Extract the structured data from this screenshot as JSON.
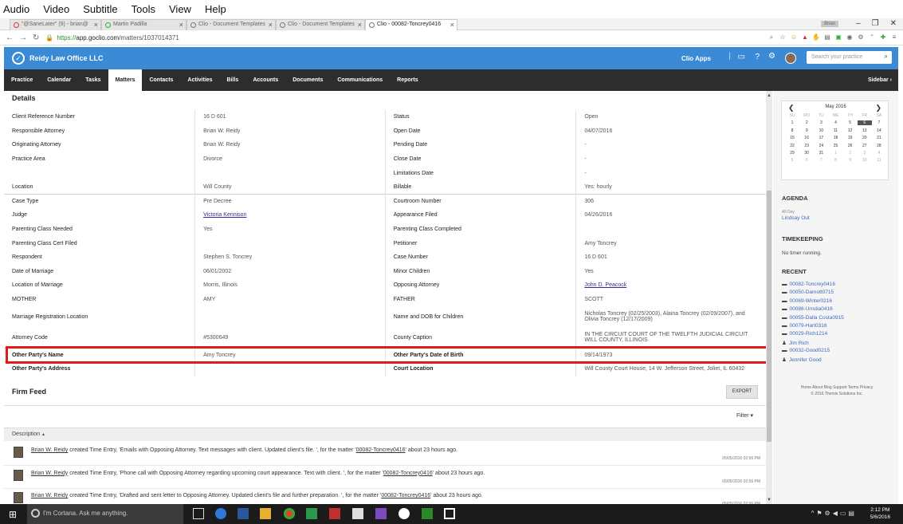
{
  "menubar": [
    "Audio",
    "Video",
    "Subtitle",
    "Tools",
    "View",
    "Help"
  ],
  "tabs": [
    {
      "label": "\"@SaneLater\" (9) - brian@"
    },
    {
      "label": "Martin Padilla"
    },
    {
      "label": "Clio - Document Templates"
    },
    {
      "label": "Clio - Document Templates"
    },
    {
      "label": "Clio - 00082-Toncrey0416"
    }
  ],
  "window_user": "Brian",
  "address": {
    "scheme": "https://",
    "host": "app.goclio.com",
    "path": "/matters/1037014371"
  },
  "topbar": {
    "firm": "Reidy Law Office LLC",
    "clio_apps": "Clio Apps",
    "search_placeholder": "Search your practice"
  },
  "nav": [
    "Practice",
    "Calendar",
    "Tasks",
    "Matters",
    "Contacts",
    "Activities",
    "Bills",
    "Accounts",
    "Documents",
    "Communications",
    "Reports"
  ],
  "nav_active": "Matters",
  "sidebar_label": "Sidebar",
  "details_title": "Details",
  "details": [
    {
      "l1": "Client Reference Number",
      "v1": "16 D 601",
      "l2": "Status",
      "v2": "Open"
    },
    {
      "l1": "Responsible Attorney",
      "v1": "Brian W. Reidy",
      "l2": "Open Date",
      "v2": "04/07/2016"
    },
    {
      "l1": "Originating Attorney",
      "v1": "Brian W. Reidy",
      "l2": "Pending Date",
      "v2": "-"
    },
    {
      "l1": "Practice Area",
      "v1": "Divorce",
      "l2": "Close Date",
      "v2": "-"
    },
    {
      "l1": "",
      "v1": "",
      "l2": "Limitations Date",
      "v2": "-"
    },
    {
      "l1": "Location",
      "v1": "Will County",
      "l2": "Billable",
      "v2": "Yes: hourly"
    },
    {
      "l1": "Case Type",
      "v1": "Pre Decree",
      "l2": "Courtroom Number",
      "v2": "306"
    },
    {
      "l1": "Judge",
      "v1": "Victoria Kennison",
      "l2": "Appearance Filed",
      "v2": "04/26/2016"
    },
    {
      "l1": "Parenting Class Needed",
      "v1": "Yes",
      "l2": "Parenting Class Completed",
      "v2": ""
    },
    {
      "l1": "Parenting Class Cert Filed",
      "v1": "",
      "l2": "Petitioner",
      "v2": "Amy Toncrey"
    },
    {
      "l1": "Respondent",
      "v1": "Stephen S. Toncrey",
      "l2": "Case Number",
      "v2": "16 D 601"
    },
    {
      "l1": "Date of Marriage",
      "v1": "06/01/2002",
      "l2": "Minor Children",
      "v2": "Yes"
    },
    {
      "l1": "Location of Marriage",
      "v1": "Morris, Illinois",
      "l2": "Opposing Attorney",
      "v2": "John D. Peacock"
    },
    {
      "l1": "MOTHER",
      "v1": "AMY",
      "l2": "FATHER",
      "v2": "SCOTT"
    },
    {
      "l1": "Marriage Registration Location",
      "v1": "",
      "l2": "Name and DOB for Children",
      "v2": "Nicholas Toncrey (02/25/2003), Alaina Toncrey (02/09/2007), and Olivia Toncrey (12/17/2009)"
    },
    {
      "l1": "Attorney Code",
      "v1": "#5300649",
      "l2": "County Caption",
      "v2": "IN THE CIRCUIT COURT OF THE TWELFTH JUDICIAL CIRCUIT WILL COUNTY, ILLINOIS"
    },
    {
      "l1": "Other Party's Name",
      "v1": "Amy Toncrey",
      "l2": "Other Party's Date of Birth",
      "v2": "09/14/1973"
    },
    {
      "l1": "Other Party's Address",
      "v1": "",
      "l2": "Court Location",
      "v2": "Will County Court House, 14 W. Jefferson Street, Joliet, IL 60432"
    }
  ],
  "feed": {
    "title": "Firm Feed",
    "export": "EXPORT",
    "filter": "Filter",
    "desc_head": "Description",
    "entries": [
      {
        "user": "Brian W. Reidy",
        "pre": " created Time Entry, 'Emails with Opposing Attorney. Text messages with client. Updated client's file. ', for the matter '",
        "matter": "00082-Toncrey0416",
        "post": "' about 23 hours ago.",
        "ts": "05/05/2016 02:56 PM"
      },
      {
        "user": "Brian W. Reidy",
        "pre": " created Time Entry, 'Phone call with Opposing Attorney regarding upcoming court appearance. Text with client. ', for the matter '",
        "matter": "00082-Toncrey0416",
        "post": "' about 23 hours ago.",
        "ts": "05/05/2016 02:56 PM"
      },
      {
        "user": "Brian W. Reidy",
        "pre": " created Time Entry, 'Drafted and sent letter to Opposing Attorney. Updated client's file and further preparation. ', for the matter '",
        "matter": "00082-Toncrey0416",
        "post": "' about 23 hours ago.",
        "ts": "05/05/2016 02:56 PM"
      }
    ]
  },
  "calendar": {
    "month": "May 2016",
    "dow": [
      "SU",
      "MO",
      "TU",
      "WE",
      "TH",
      "FR",
      "SA"
    ],
    "days": [
      [
        "1",
        ""
      ],
      [
        "2",
        ""
      ],
      [
        "3",
        ""
      ],
      [
        "4",
        ""
      ],
      [
        "5",
        ""
      ],
      [
        "6",
        "today"
      ],
      [
        "7",
        ""
      ],
      [
        "8",
        ""
      ],
      [
        "9",
        ""
      ],
      [
        "10",
        ""
      ],
      [
        "11",
        ""
      ],
      [
        "12",
        ""
      ],
      [
        "13",
        ""
      ],
      [
        "14",
        ""
      ],
      [
        "15",
        ""
      ],
      [
        "16",
        ""
      ],
      [
        "17",
        ""
      ],
      [
        "18",
        ""
      ],
      [
        "19",
        ""
      ],
      [
        "20",
        ""
      ],
      [
        "21",
        ""
      ],
      [
        "22",
        ""
      ],
      [
        "23",
        ""
      ],
      [
        "24",
        ""
      ],
      [
        "25",
        ""
      ],
      [
        "26",
        ""
      ],
      [
        "27",
        ""
      ],
      [
        "28",
        ""
      ],
      [
        "29",
        ""
      ],
      [
        "30",
        ""
      ],
      [
        "31",
        ""
      ],
      [
        "1",
        "dim"
      ],
      [
        "2",
        "dim"
      ],
      [
        "3",
        "dim"
      ],
      [
        "4",
        "dim"
      ],
      [
        "5",
        "dim"
      ],
      [
        "6",
        "dim"
      ],
      [
        "7",
        "dim"
      ],
      [
        "8",
        "dim"
      ],
      [
        "9",
        "dim"
      ],
      [
        "10",
        "dim"
      ],
      [
        "11",
        "dim"
      ]
    ]
  },
  "agenda": {
    "title": "AGENDA",
    "sub": "All Day",
    "item": "Lindsay Out"
  },
  "timekeeping": {
    "title": "TIMEKEEPING",
    "text": "No timer running."
  },
  "recent": {
    "title": "RECENT",
    "items": [
      {
        "label": "00082-Toncrey0416",
        "icon": "briefcase-icon"
      },
      {
        "label": "00050-Damott0715",
        "icon": "briefcase-icon"
      },
      {
        "label": "00069-Winter0216",
        "icon": "briefcase-icon"
      },
      {
        "label": "00086-Urrutia0416",
        "icon": "briefcase-icon"
      },
      {
        "label": "00055-Dalla Costa0915",
        "icon": "briefcase-icon"
      },
      {
        "label": "00079-Hart0316",
        "icon": "briefcase-icon"
      },
      {
        "label": "00029-Rich1214",
        "icon": "briefcase-icon"
      },
      {
        "label": "Jim Rich",
        "icon": "person-icon"
      },
      {
        "label": "00032-Good0215",
        "icon": "briefcase-icon"
      },
      {
        "label": "Jennifer Good",
        "icon": "person-icon"
      }
    ]
  },
  "footer": {
    "links": "Home  About  Blog  Support  Terms  Privacy",
    "copy": "© 2016 Themis Solutions Inc."
  },
  "taskbar": {
    "cortana": "I'm Cortana. Ask me anything.",
    "time": "2:12 PM",
    "date": "5/6/2016"
  },
  "colors": {
    "brand": "#3a8ad6",
    "nav": "#2d2d2d",
    "highlight": "#e21a1a"
  }
}
